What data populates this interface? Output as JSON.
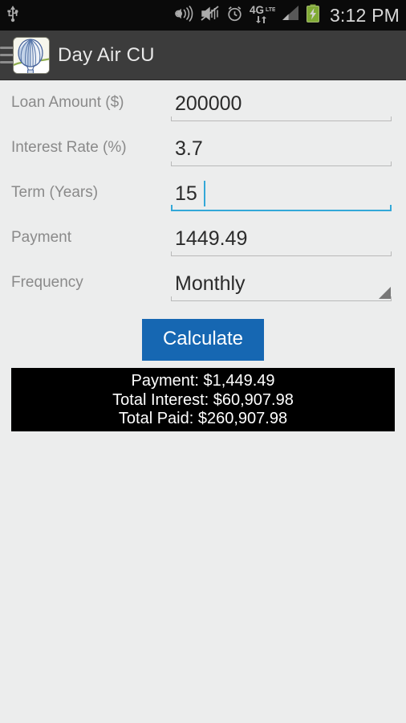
{
  "statusbar": {
    "time": "3:12 PM",
    "icons": [
      {
        "name": "usb-icon",
        "label": "usb"
      },
      {
        "name": "sound-waves-icon",
        "label": "ringer-sound"
      },
      {
        "name": "mute-vibrate-icon",
        "label": "mute-vibrate"
      },
      {
        "name": "alarm-clock-icon",
        "label": "alarm"
      },
      {
        "name": "network-4glte-icon",
        "label": "4G LTE"
      },
      {
        "name": "signal-bars-icon",
        "label": "signal"
      },
      {
        "name": "battery-charging-icon",
        "label": "battery-charging"
      }
    ],
    "network_label": "4G",
    "network_sub": "LTE",
    "background": "#0a0a0a",
    "text_color": "#d8d8d8",
    "battery_color": "#8bc34a"
  },
  "actionbar": {
    "title": "Day Air CU",
    "menu_icon": "hamburger-menu-icon",
    "app_icon": "hot-air-balloon-app-icon",
    "background": "#3c3c3c"
  },
  "form": {
    "fields": [
      {
        "name": "loan-amount",
        "label": "Loan Amount ($)",
        "value": "200000",
        "type": "text",
        "focused": false
      },
      {
        "name": "interest-rate",
        "label": "Interest Rate (%)",
        "value": "3.7",
        "type": "text",
        "focused": false
      },
      {
        "name": "term-years",
        "label": "Term (Years)",
        "value": "15",
        "type": "text",
        "focused": true
      },
      {
        "name": "payment",
        "label": "Payment",
        "value": "1449.49",
        "type": "text",
        "focused": false
      },
      {
        "name": "frequency",
        "label": "Frequency",
        "value": "Monthly",
        "type": "spinner",
        "focused": false
      }
    ],
    "focus_color": "#33a8d8",
    "label_color": "#8a8a8a"
  },
  "actions": {
    "calculate_label": "Calculate",
    "calculate_color": "#1667b2"
  },
  "results": {
    "payment": "Payment: $1,449.49",
    "total_interest": "Total Interest: $60,907.98",
    "total_paid": "Total Paid: $260,907.98",
    "background": "#000000",
    "text_color": "#ffffff"
  },
  "page": {
    "background": "#eceded"
  }
}
